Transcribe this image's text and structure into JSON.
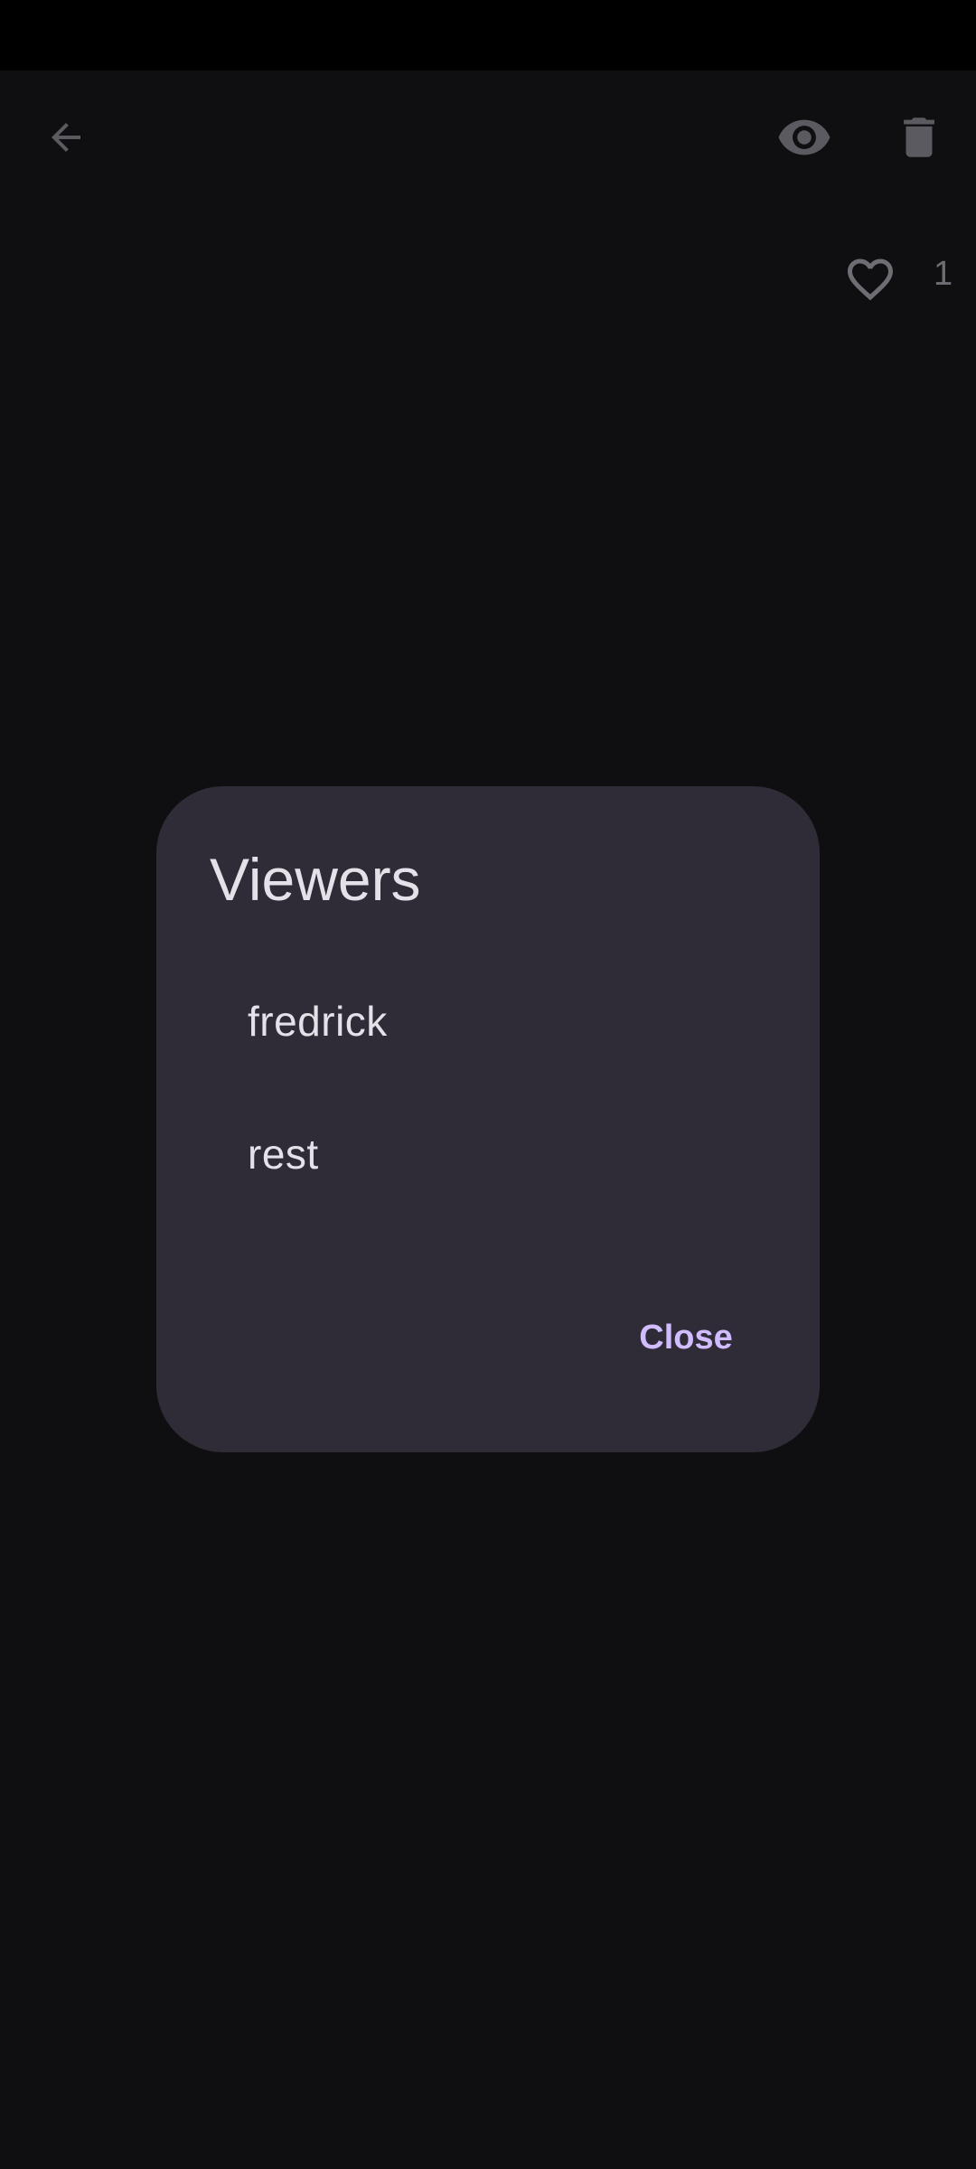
{
  "top_bar": {
    "back_icon": "arrow-back-icon",
    "viewers_icon": "eye-icon",
    "delete_icon": "trash-icon"
  },
  "likes": {
    "icon": "heart-outline-icon",
    "count": "1"
  },
  "dialog": {
    "title": "Viewers",
    "viewers": [
      {
        "name": "fredrick"
      },
      {
        "name": "rest"
      }
    ],
    "close_label": "Close"
  },
  "colors": {
    "background": "#0f0f11",
    "status_bar": "#000000",
    "dialog_surface": "#2f2c38",
    "dialog_text": "#e6e1e9",
    "accent": "#d0bcff",
    "dimmed_icon": "#6e6d73"
  }
}
